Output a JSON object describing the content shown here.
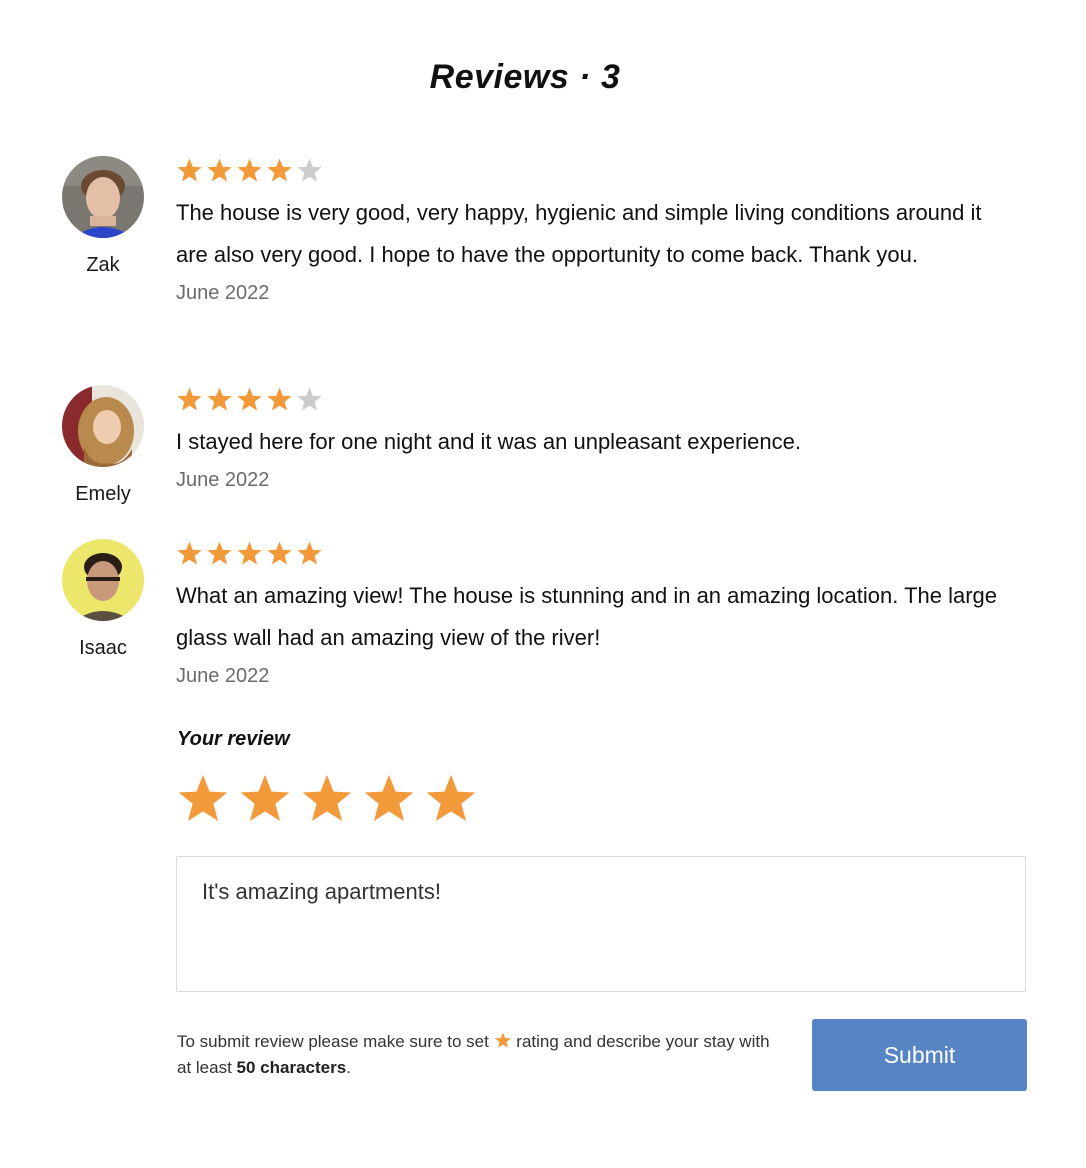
{
  "page": {
    "title": "Reviews · 3"
  },
  "colors": {
    "star_filled": "#f2993a",
    "star_empty": "#cccccc",
    "submit_bg": "#5684c4"
  },
  "reviews": [
    {
      "name": "Zak",
      "rating": 4,
      "max_rating": 5,
      "text": "The house is very good, very happy, hygienic and simple living conditions around it are also very good. I hope to have the opportunity to come back. Thank you.",
      "date": "June 2022"
    },
    {
      "name": "Emely",
      "rating": 4,
      "max_rating": 5,
      "text": "I stayed here for one night and it was an unpleasant experience.",
      "date": "June 2022"
    },
    {
      "name": "Isaac",
      "rating": 5,
      "max_rating": 5,
      "text": "What an amazing view! The house is stunning and in an amazing location. The large glass wall had an amazing view of the river!",
      "date": "June 2022"
    }
  ],
  "your_review": {
    "label": "Your review",
    "rating": 5,
    "max_rating": 5,
    "value": "It's amazing apartments!",
    "hint_before": "To submit review please make sure to set",
    "hint_middle": "rating and describe your stay with at least",
    "hint_bold": "50 characters",
    "hint_after": ".",
    "submit_label": "Submit"
  }
}
